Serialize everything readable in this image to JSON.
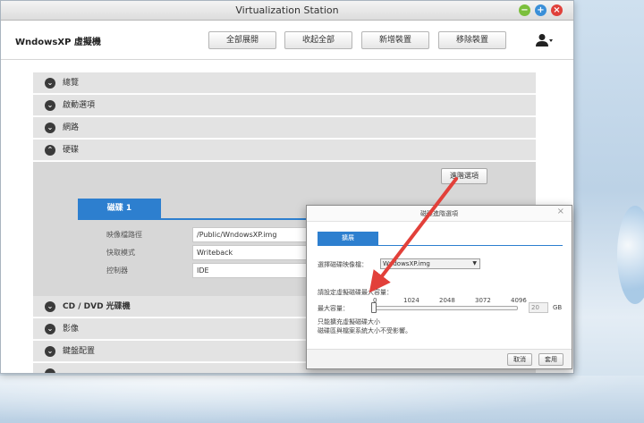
{
  "window": {
    "title": "Virtualization Station"
  },
  "header": {
    "vm_name": "WndowsXP 虛擬機",
    "buttons": [
      "全部展開",
      "收起全部",
      "新增裝置",
      "移除裝置"
    ]
  },
  "sections": [
    {
      "label": "總覽",
      "expanded": false
    },
    {
      "label": "啟動選項",
      "expanded": false
    },
    {
      "label": "網路",
      "expanded": false
    },
    {
      "label": "硬碟",
      "expanded": true
    },
    {
      "label": "CD / DVD 光碟機",
      "expanded": false
    },
    {
      "label": "影像",
      "expanded": false
    },
    {
      "label": "鍵盤配置",
      "expanded": false
    }
  ],
  "disk": {
    "advanced_button": "進階選項",
    "tab_label": "磁碟 1",
    "rows": [
      {
        "label": "映像檔路徑",
        "value": "/Public/WndowsXP.img"
      },
      {
        "label": "快取模式",
        "value": "Writeback"
      },
      {
        "label": "控制器",
        "value": "IDE"
      }
    ]
  },
  "dialog": {
    "title": "磁碟進階選項",
    "tab": "擴展",
    "image_label": "選擇磁碟映像檔：",
    "image_value": "WndowsXP.img",
    "size_heading": "請設定虛擬磁碟最大容量：",
    "size_label": "最大容量：",
    "ticks": [
      "0",
      "1024",
      "2048",
      "3072",
      "4096"
    ],
    "size_value": "20",
    "size_unit": "GB",
    "slider_level": 0,
    "note_1": "只能擴充虛擬磁碟大小",
    "note_2": "磁碟區與檔案系統大小不受影響。",
    "cancel": "取消",
    "apply": "套用"
  }
}
